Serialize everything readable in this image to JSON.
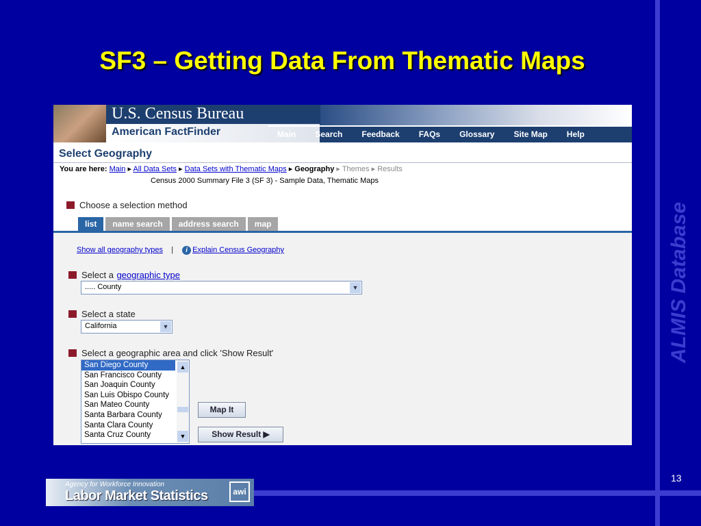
{
  "slide": {
    "title": "SF3 – Getting Data From Thematic Maps",
    "side_label": "ALMIS Database",
    "page_number": "13",
    "logo": {
      "agency": "Agency for Workforce Innovation",
      "name": "Labor Market Statistics",
      "mark": "awi"
    }
  },
  "header": {
    "bureau": "U.S. Census Bureau",
    "product": "American FactFinder",
    "nav": [
      "Main",
      "Search",
      "Feedback",
      "FAQs",
      "Glossary",
      "Site Map",
      "Help"
    ]
  },
  "page": {
    "title": "Select Geography",
    "breadcrumb": {
      "label": "You are here:",
      "links": [
        "Main",
        "All Data Sets",
        "Data Sets with Thematic Maps"
      ],
      "current": "Geography",
      "upcoming": [
        "Themes",
        "Results"
      ]
    },
    "dataset": "Census 2000 Summary File 3 (SF 3) - Sample Data, Thematic Maps",
    "method_label": "Choose a selection method",
    "tabs": [
      "list",
      "name search",
      "address search",
      "map"
    ],
    "show_all_link": "Show all geography types",
    "separator": "|",
    "explain_link": "Explain Census Geography",
    "geo_type": {
      "prefix": "Select a",
      "link": "geographic type",
      "value": "..... County"
    },
    "state": {
      "label": "Select a state",
      "value": "California"
    },
    "area": {
      "label": "Select a geographic area and click 'Show Result'",
      "items": [
        "San Diego County",
        "San Francisco County",
        "San Joaquin County",
        "San Luis Obispo County",
        "San Mateo County",
        "Santa Barbara County",
        "Santa Clara County",
        "Santa Cruz County"
      ],
      "selected": "San Diego County"
    },
    "map_button": "Map It",
    "show_button": "Show Result ▶"
  }
}
